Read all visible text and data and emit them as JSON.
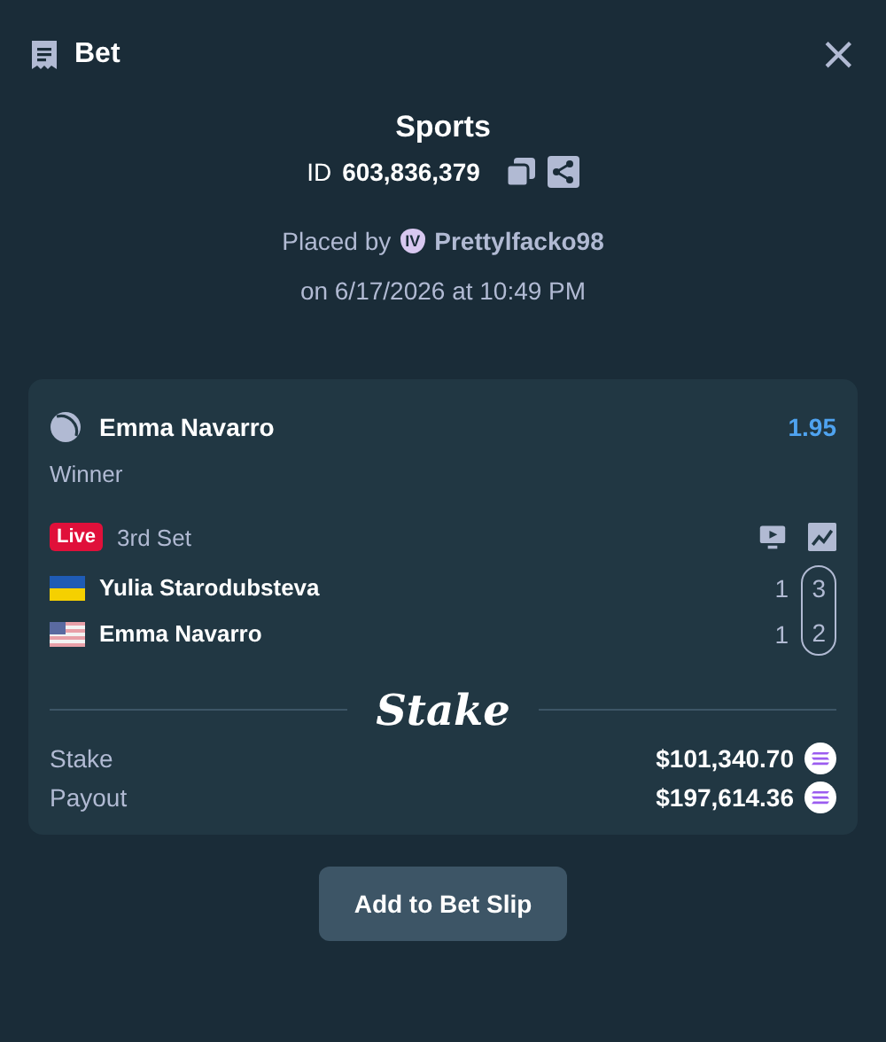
{
  "header": {
    "title": "Bet",
    "close": "×"
  },
  "summary": {
    "category": "Sports",
    "id_label": "ID",
    "id_value": "603,836,379",
    "placed_by": "Placed by",
    "user_rank": "IV",
    "username": "Prettylfacko98",
    "date": "on 6/17/2026 at 10:49 PM"
  },
  "selection": {
    "name": "Emma Navarro",
    "odds": "1.95",
    "market": "Winner",
    "live": true,
    "live_label": "Live",
    "period": "3rd Set",
    "players": [
      {
        "name": "Yulia Starodubsteva",
        "kind": "ukraine",
        "set_score": "1",
        "game_score": "3"
      },
      {
        "name": "Emma Navarro",
        "kind": "usa",
        "set_score": "1",
        "game_score": "2"
      }
    ],
    "logo": "Stake",
    "amounts": [
      {
        "label": "Stake",
        "value": "$101,340.70"
      },
      {
        "label": "Payout",
        "value": "$197,614.36"
      }
    ]
  },
  "button": "Add to Bet Slip"
}
